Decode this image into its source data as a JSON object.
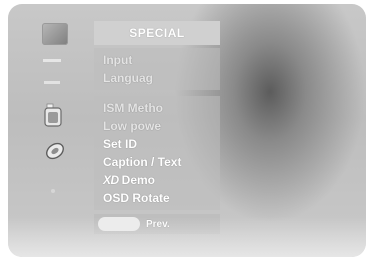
{
  "menu": {
    "title": "SPECIAL",
    "group1": [
      {
        "label": "Input"
      },
      {
        "label": "Languag"
      }
    ],
    "group2": [
      {
        "label": "ISM Metho"
      },
      {
        "label": "Low powe"
      },
      {
        "label": "Set ID"
      },
      {
        "label": "Caption / Text"
      },
      {
        "label": "Demo",
        "logo": "XD"
      },
      {
        "label": "OSD Rotate"
      }
    ],
    "footer": {
      "prev_label": "Prev."
    }
  },
  "icons": {
    "picture": "picture-menu-icon",
    "bottle": "bottle-menu-icon",
    "pen": "pen-menu-icon"
  }
}
